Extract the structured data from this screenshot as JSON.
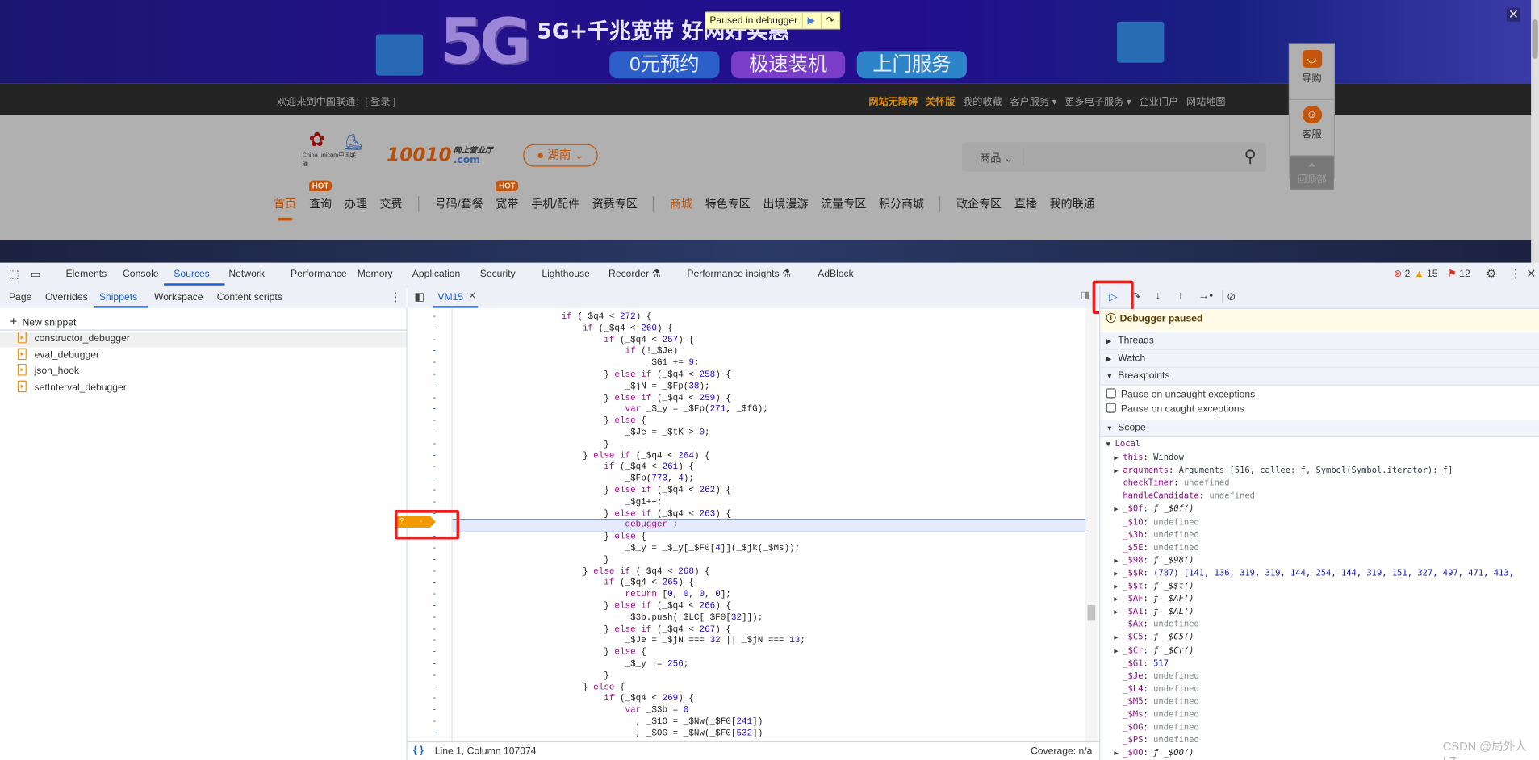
{
  "website": {
    "banner": {
      "big_text": "5G",
      "slogan": "5G+千兆宽带  好网好实惠",
      "buttons": [
        "0元预约",
        "极速装机",
        "上门服务"
      ],
      "close_icon": "close-icon"
    },
    "paused_overlay": {
      "label": "Paused in debugger",
      "resume_icon": "resume-icon",
      "step_over_icon": "step-over-icon"
    },
    "topbar": {
      "welcome": "欢迎来到中国联通！[ 登录 ]",
      "links": [
        {
          "label": "网站无障碍",
          "highlight": true
        },
        {
          "label": "关怀版",
          "highlight": true
        },
        {
          "label": "我的收藏"
        },
        {
          "label": "客户服务 ▾"
        },
        {
          "label": "更多电子服务 ▾"
        },
        {
          "label": "企业门户"
        },
        {
          "label": "网站地图"
        }
      ]
    },
    "logo": {
      "brand": "China unicom中国联通",
      "number": "10010",
      "sub": "网上营业厅",
      "domain": ".com"
    },
    "location": "湖南",
    "search": {
      "category": "商品",
      "placeholder": ""
    },
    "nav": [
      {
        "label": "首页",
        "active": true
      },
      {
        "label": "查询",
        "hot": "HOT"
      },
      {
        "label": "办理"
      },
      {
        "label": "交费",
        "divider_after": true
      },
      {
        "label": "号码/套餐"
      },
      {
        "label": "宽带",
        "hot": "HOT"
      },
      {
        "label": "手机/配件"
      },
      {
        "label": "资费专区",
        "divider_after": true
      },
      {
        "label": "商城",
        "orange": true
      },
      {
        "label": "特色专区"
      },
      {
        "label": "出境漫游"
      },
      {
        "label": "流量专区"
      },
      {
        "label": "积分商城",
        "divider_after": true
      },
      {
        "label": "政企专区"
      },
      {
        "label": "直播"
      },
      {
        "label": "我的联通"
      }
    ],
    "float_panel": {
      "guide": "导购",
      "service": "客服",
      "top": "回顶部"
    }
  },
  "devtools": {
    "main_tabs": [
      "Elements",
      "Console",
      "Sources",
      "Network",
      "Performance",
      "Memory",
      "Application",
      "Security",
      "Lighthouse",
      "Recorder ⚗",
      "Performance insights ⚗",
      "AdBlock"
    ],
    "active_tab": "Sources",
    "counts": {
      "errors": "2",
      "warnings": "15",
      "issues": "12"
    },
    "colors": {
      "accent": "#1a5fd0",
      "error": "#d93025",
      "warning": "#f29900",
      "breakpoint": "#f29900",
      "highlight_box": "#f01d1d"
    },
    "sub_tabs": [
      "Page",
      "Overrides",
      "Snippets",
      "Workspace",
      "Content scripts"
    ],
    "active_sub_tab": "Snippets",
    "new_snippet": "New snippet",
    "snippets": [
      "constructor_debugger",
      "eval_debugger",
      "json_hook",
      "setInterval_debugger"
    ],
    "editor_tab": "VM15",
    "code_lines": [
      "                    if (_$q4 < 272) {",
      "                        if (_$q4 < 260) {",
      "                            if (_$q4 < 257) {",
      "                                if (!_$Je)",
      "                                    _$G1 += 9;",
      "                            } else if (_$q4 < 258) {",
      "                                _$jN = _$Fp(38);",
      "                            } else if (_$q4 < 259) {",
      "                                var _$_y = _$Fp(271, _$fG);",
      "                            } else {",
      "                                _$Je = _$tK > 0;",
      "                            }",
      "                        } else if (_$q4 < 264) {",
      "                            if (_$q4 < 261) {",
      "                                _$Fp(773, 4);",
      "                            } else if (_$q4 < 262) {",
      "                                _$gi++;",
      "                            } else if (_$q4 < 263) {",
      "                                debugger ;",
      "                            } else {",
      "                                _$_y = _$_y[_$F0[4]](_$jk(_$Ms));",
      "                            }",
      "                        } else if (_$q4 < 268) {",
      "                            if (_$q4 < 265) {",
      "                                return [0, 0, 0, 0];",
      "                            } else if (_$q4 < 266) {",
      "                                _$3b.push(_$LC[_$F0[32]]);",
      "                            } else if (_$q4 < 267) {",
      "                                _$Je = _$jN === 32 || _$jN === 13;",
      "                            } else {",
      "                                _$_y |= 256;",
      "                            }",
      "                        } else {",
      "                            if (_$q4 < 269) {",
      "                                var _$3b = 0",
      "                                  , _$1O = _$Nw(_$F0[241])",
      "                                  , _$OG = _$Nw(_$F0[532])"
    ],
    "gutter_mark": "-",
    "paused_line_index": 18,
    "breakpoint_marker": {
      "condition": "?",
      "line": "-"
    },
    "status": {
      "position": "Line 1, Column 107074",
      "coverage": "Coverage: n/a",
      "format_icon": "pretty-print-icon"
    },
    "debugger": {
      "paused": "Debugger paused",
      "sections": {
        "threads": "Threads",
        "watch": "Watch",
        "breakpoints": "Breakpoints",
        "scope": "Scope"
      },
      "checkboxes": [
        {
          "label": "Pause on uncaught exceptions",
          "checked": false
        },
        {
          "label": "Pause on caught exceptions",
          "checked": false
        }
      ],
      "scope_local": "Local",
      "scope": [
        {
          "name": "this",
          "value": "Window",
          "type": "obj",
          "expandable": true
        },
        {
          "name": "arguments",
          "value": "Arguments [516, callee: ƒ, Symbol(Symbol.iterator): ƒ]",
          "type": "obj",
          "expandable": true
        },
        {
          "name": "checkTimer",
          "value": "undefined",
          "type": "undefined"
        },
        {
          "name": "handleCandidate",
          "value": "undefined",
          "type": "undefined"
        },
        {
          "name": "_$0f",
          "value": "ƒ _$0f()",
          "type": "fn",
          "expandable": true
        },
        {
          "name": "_$1O",
          "value": "undefined",
          "type": "undefined"
        },
        {
          "name": "_$3b",
          "value": "undefined",
          "type": "undefined"
        },
        {
          "name": "_$5E",
          "value": "undefined",
          "type": "undefined"
        },
        {
          "name": "_$98",
          "value": "ƒ _$98()",
          "type": "fn",
          "expandable": true
        },
        {
          "name": "_$$R",
          "value": "(787) [141, 136, 319, 319, 144, 254, 144, 319, 151, 327, 497, 471, 413,",
          "type": "num",
          "expandable": true
        },
        {
          "name": "_$$t",
          "value": "ƒ _$$t()",
          "type": "fn",
          "expandable": true
        },
        {
          "name": "_$AF",
          "value": "ƒ _$AF()",
          "type": "fn",
          "expandable": true
        },
        {
          "name": "_$A1",
          "value": "ƒ _$AL()",
          "type": "fn",
          "expandable": true
        },
        {
          "name": "_$Ax",
          "value": "undefined",
          "type": "undefined"
        },
        {
          "name": "_$C5",
          "value": "ƒ _$C5()",
          "type": "fn",
          "expandable": true
        },
        {
          "name": "_$Cr",
          "value": "ƒ _$Cr()",
          "type": "fn",
          "expandable": true
        },
        {
          "name": "_$G1",
          "value": "517",
          "type": "num"
        },
        {
          "name": "_$Je",
          "value": "undefined",
          "type": "undefined"
        },
        {
          "name": "_$L4",
          "value": "undefined",
          "type": "undefined"
        },
        {
          "name": "_$M5",
          "value": "undefined",
          "type": "undefined"
        },
        {
          "name": "_$Ms",
          "value": "undefined",
          "type": "undefined"
        },
        {
          "name": "_$OG",
          "value": "undefined",
          "type": "undefined"
        },
        {
          "name": "_$PS",
          "value": "undefined",
          "type": "undefined"
        },
        {
          "name": "_$OO",
          "value": "ƒ _$OO()",
          "type": "fn",
          "expandable": true
        }
      ]
    }
  },
  "watermark": "CSDN @局外人LZ"
}
